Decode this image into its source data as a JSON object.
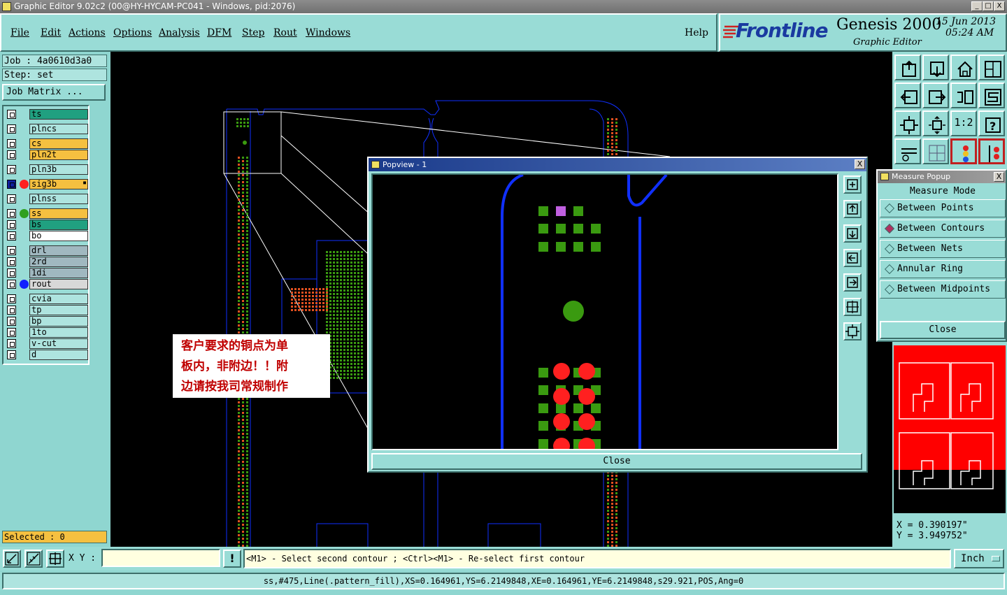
{
  "window": {
    "title": "Graphic Editor 9.02c2 (00@HY-HYCAM-PC041 - Windows, pid:2076)",
    "min": "_",
    "max": "□",
    "close": "X"
  },
  "menu": {
    "items": [
      "File",
      "Edit",
      "Actions",
      "Options",
      "Analysis",
      "DFM",
      "Step",
      "Rout",
      "Windows"
    ],
    "help": "Help"
  },
  "brand": {
    "logo": "Frontline",
    "product": "Genesis 2000",
    "subtitle": "Graphic Editor",
    "date": "15 Jun 2013",
    "time": "05:24 AM"
  },
  "job": {
    "job_label": "Job : 4a0610d3a0",
    "step_label": "Step: set",
    "matrix_button": "Job Matrix ..."
  },
  "layers": [
    {
      "name": "ts",
      "color": "#20a080",
      "dot": ""
    },
    {
      "name": "plncs",
      "color": "#aee4df",
      "dot": ""
    },
    {
      "name": "cs",
      "color": "#f5c040",
      "dot": ""
    },
    {
      "name": "pln2t",
      "color": "#f5c040",
      "dot": ""
    },
    {
      "name": "pln3b",
      "color": "#aee4df",
      "dot": ""
    },
    {
      "name": "sig3b",
      "color": "#f5c040",
      "dot": "#ff2020",
      "mark": "▪"
    },
    {
      "name": "plnss",
      "color": "#aee4df",
      "dot": ""
    },
    {
      "name": "ss",
      "color": "#f5c040",
      "dot": "#30a020"
    },
    {
      "name": "bs",
      "color": "#20a080",
      "dot": ""
    },
    {
      "name": "bo",
      "color": "#ffffff",
      "dot": ""
    },
    {
      "name": "drl",
      "color": "#a0b8c0",
      "dot": ""
    },
    {
      "name": "2rd",
      "color": "#a0b8c0",
      "dot": ""
    },
    {
      "name": "1di",
      "color": "#a0b8c0",
      "dot": ""
    },
    {
      "name": "rout",
      "color": "#d8d8d8",
      "dot": "#1020ff"
    },
    {
      "name": "cvia",
      "color": "#aee4df",
      "dot": ""
    },
    {
      "name": "tp",
      "color": "#aee4df",
      "dot": ""
    },
    {
      "name": "bp",
      "color": "#aee4df",
      "dot": ""
    },
    {
      "name": "1to",
      "color": "#aee4df",
      "dot": ""
    },
    {
      "name": "v-cut",
      "color": "#aee4df",
      "dot": ""
    },
    {
      "name": "d",
      "color": "#aee4df",
      "dot": ""
    }
  ],
  "selected": "Selected : 0",
  "popview": {
    "title": "Popview - 1",
    "close_x": "X",
    "close_button": "Close"
  },
  "measure": {
    "title": "Measure Popup",
    "close_x": "X",
    "heading": "Measure Mode",
    "options": [
      "Between Points",
      "Between Contours",
      "Between Nets",
      "Annular Ring",
      "Between Midpoints"
    ],
    "selected_option": "Between Contours",
    "close_button": "Close"
  },
  "note": {
    "lines": [
      "客户要求的铜点为单",
      "板内，非附边！！附",
      "边请按我司常规制作"
    ]
  },
  "zoom_buttons": {
    "one_to_two": "1:2",
    "help": "?"
  },
  "coords": {
    "x": "X = 0.390197\"",
    "y": "Y = 3.949752\""
  },
  "bottom": {
    "xy_label": "X Y :",
    "xy_value": "",
    "alert": "!",
    "prompt": "<M1> - Select second contour ; <Ctrl><M1> - Re-select first contour",
    "units": "Inch"
  },
  "status": "ss,#475,Line(.pattern_fill),XS=0.164961,YS=6.2149848,XE=0.164961,YE=6.2149848,s29.921,POS,Ang=0",
  "colors": {
    "panel": "#99dcd6",
    "popview_title": "#1a3a8a",
    "note_text": "#c00000",
    "routing": "#1030ff",
    "pad_green": "#3a9a10",
    "pad_red": "#ff2020",
    "pad_orange": "#e05020"
  }
}
